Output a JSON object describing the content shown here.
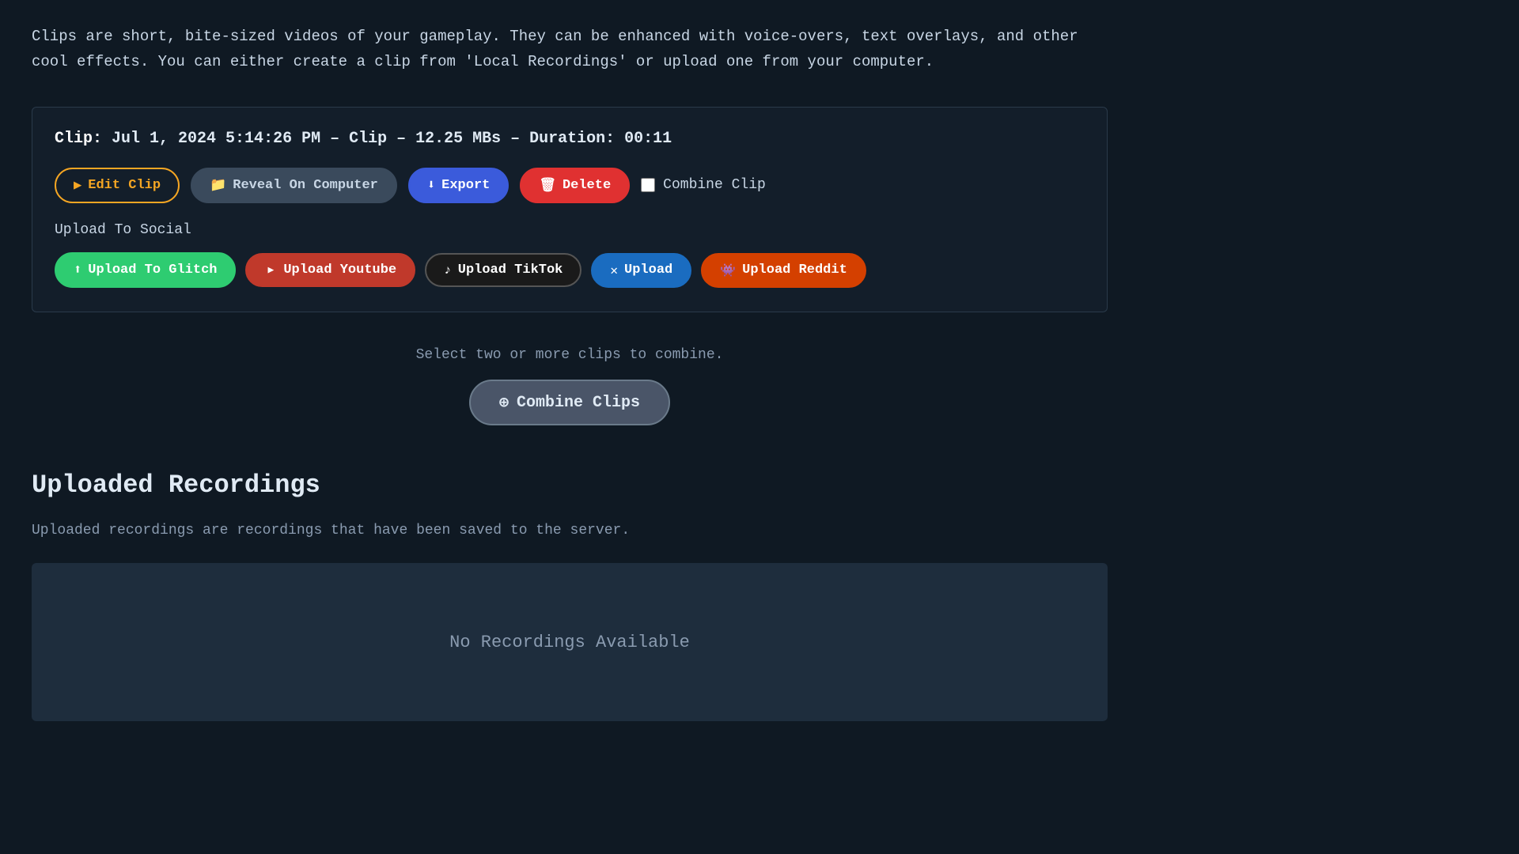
{
  "intro": {
    "text": "Clips are short, bite-sized videos of your gameplay. They can be enhanced with voice-overs,\ntext overlays, and other cool effects. You can either create a clip from 'Local Recordings'\nor upload one from your computer."
  },
  "clip_card": {
    "clip_label": "Clip:",
    "clip_info": "Jul 1, 2024 5:14:26 PM – Clip – 12.25 MBs – Duration: 00:11",
    "btn_edit": "Edit Clip",
    "btn_reveal": "Reveal On Computer",
    "btn_export": "Export",
    "btn_delete": "Delete",
    "combine_clip_label": "Combine Clip",
    "upload_to_social_label": "Upload To Social",
    "btn_glitch": "Upload To Glitch",
    "btn_youtube": "Upload Youtube",
    "btn_tiktok": "Upload TikTok",
    "btn_twitter": "Upload",
    "btn_reddit": "Upload Reddit"
  },
  "combine_section": {
    "hint": "Select two or more clips to combine.",
    "btn_label": "⊕  Combine Clips"
  },
  "uploaded_recordings": {
    "title": "Uploaded Recordings",
    "description": "Uploaded recordings are recordings that have been saved to the server.",
    "empty_message": "No Recordings Available"
  },
  "icons": {
    "play": "▶",
    "folder": "📁",
    "download": "⬇",
    "trash": "🗑",
    "upload_glitch": "⬆",
    "youtube_icon": "▶",
    "tiktok_icon": "◎",
    "twitter_icon": "✕",
    "reddit_icon": "●",
    "combine_icon": "⊕"
  }
}
